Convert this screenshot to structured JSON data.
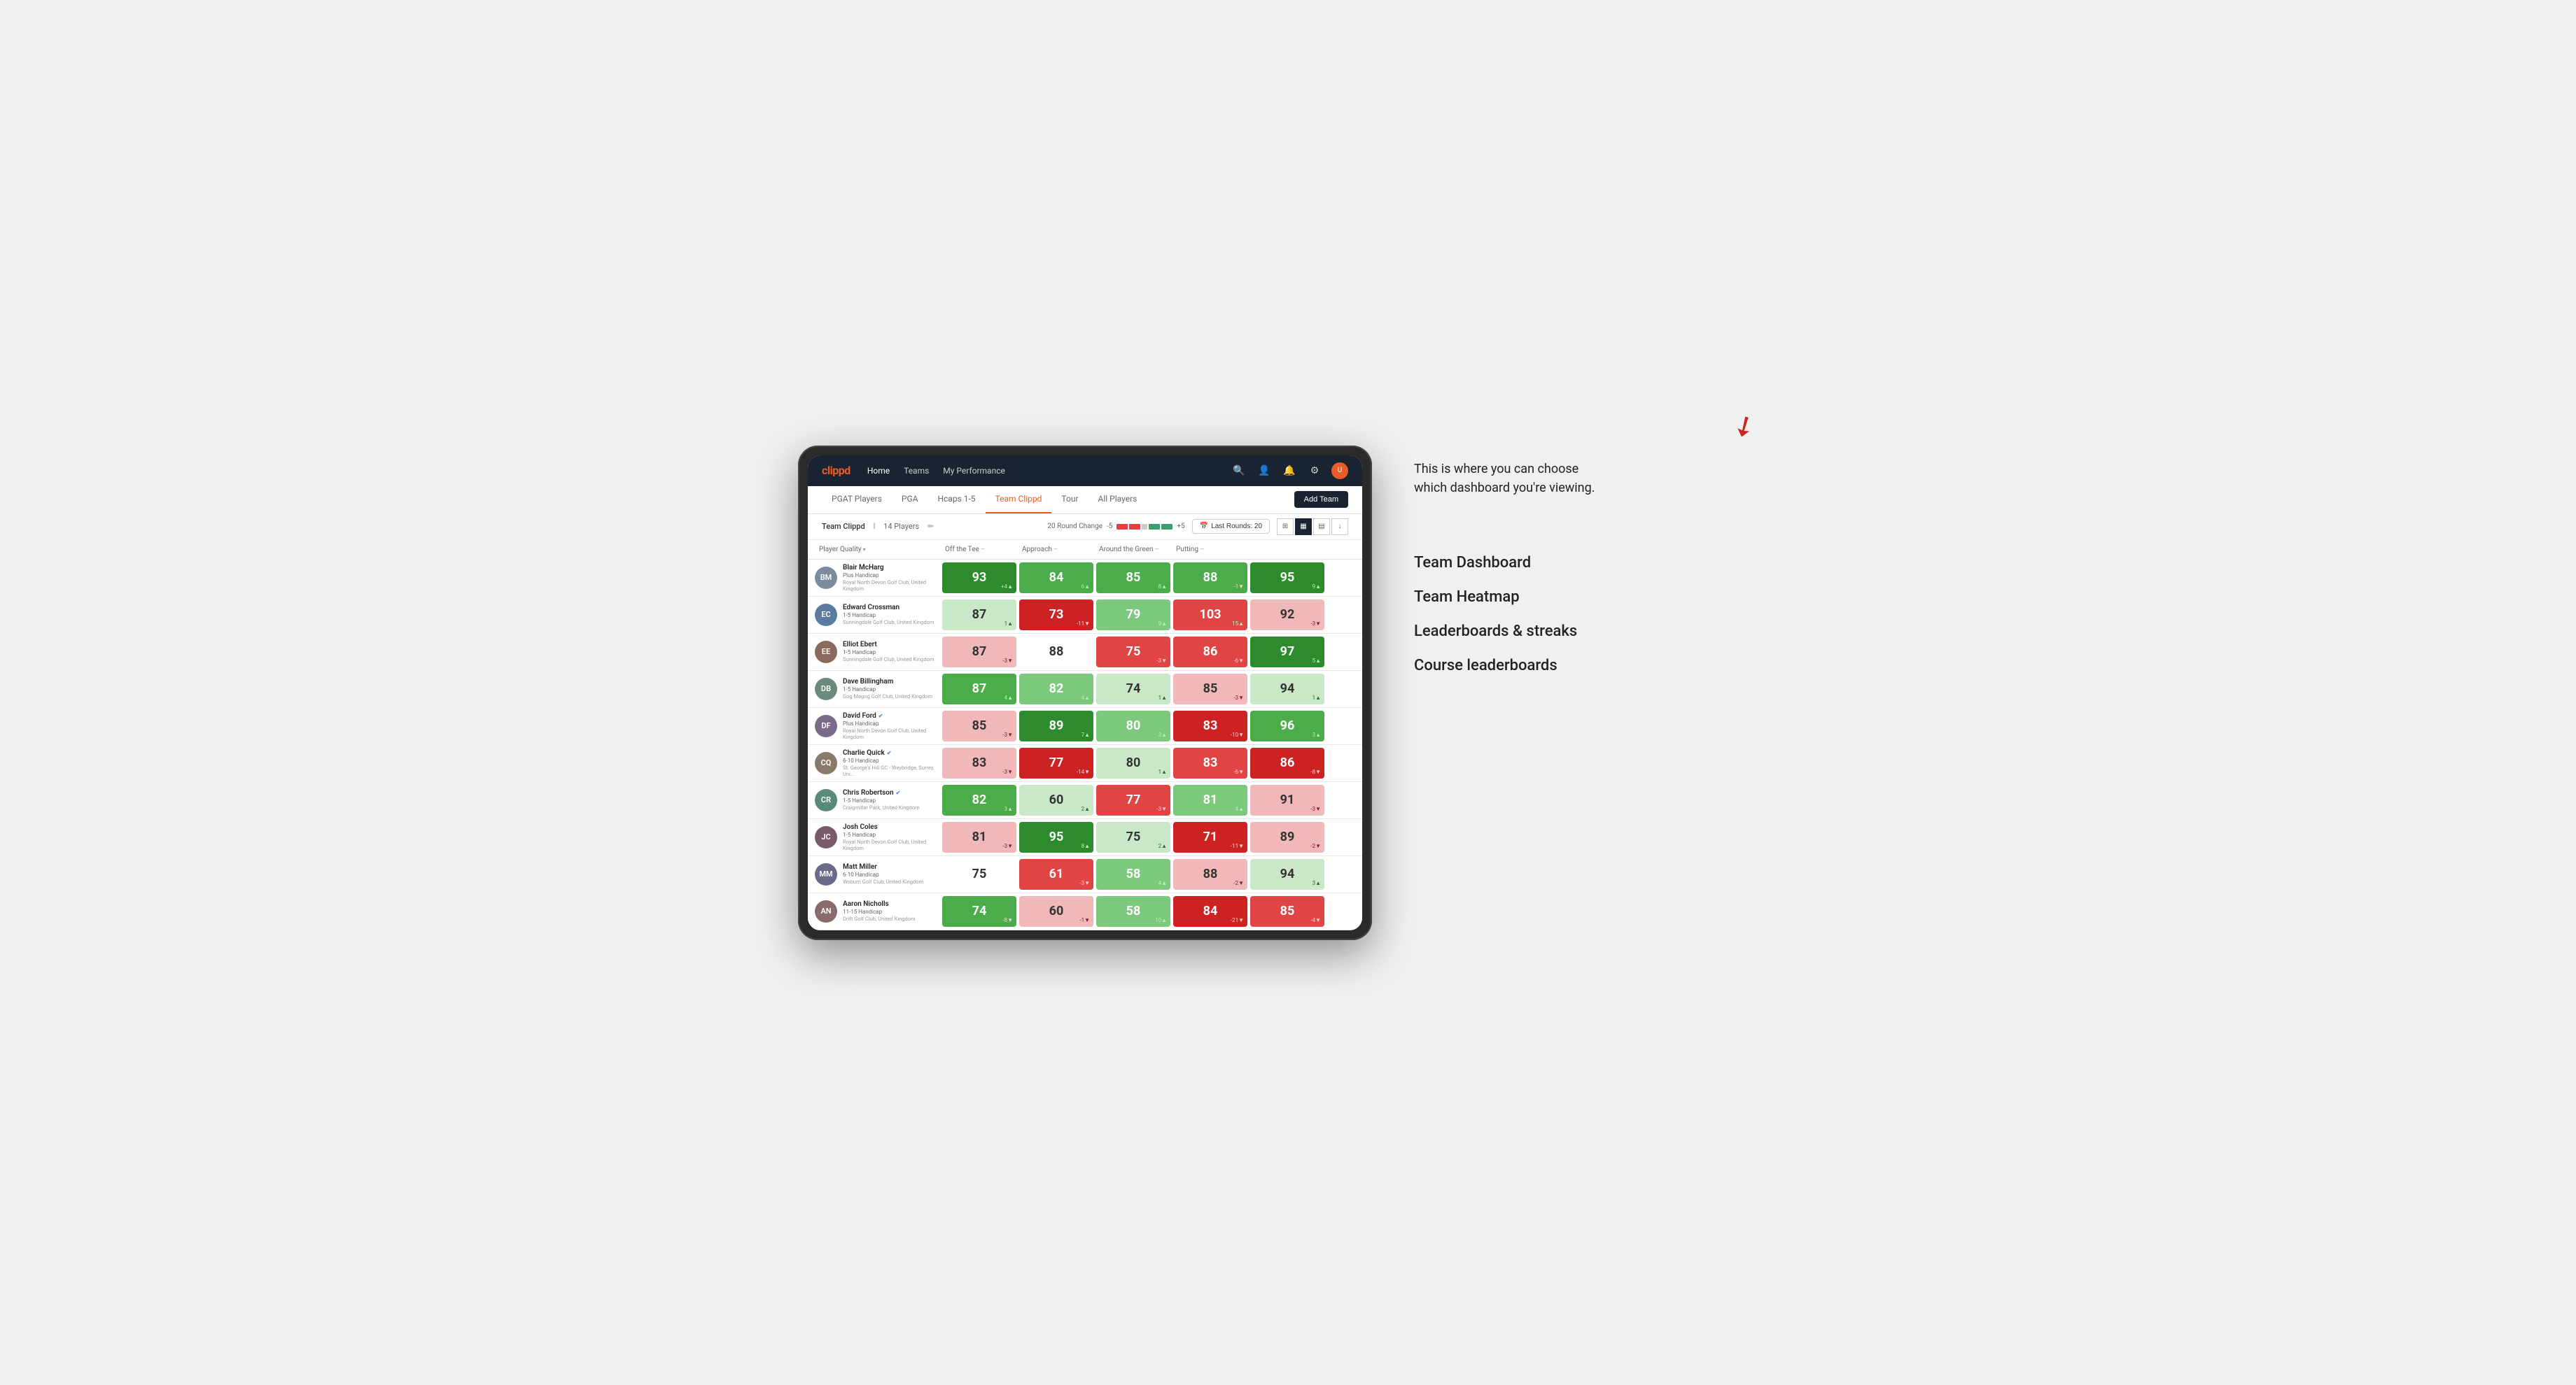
{
  "annotation": {
    "description": "This is where you can choose which dashboard you're viewing.",
    "options": [
      {
        "label": "Team Dashboard"
      },
      {
        "label": "Team Heatmap"
      },
      {
        "label": "Leaderboards & streaks"
      },
      {
        "label": "Course leaderboards"
      }
    ]
  },
  "nav": {
    "logo": "clippd",
    "links": [
      "Home",
      "Teams",
      "My Performance"
    ],
    "icons": [
      "search",
      "user",
      "bell",
      "settings"
    ]
  },
  "subNav": {
    "tabs": [
      "PGAT Players",
      "PGA",
      "Hcaps 1-5",
      "Team Clippd",
      "Tour",
      "All Players"
    ],
    "activeTab": "Team Clippd",
    "addTeamLabel": "Add Team"
  },
  "teamControls": {
    "teamName": "Team Clippd",
    "playerCount": "14 Players",
    "roundChangeLabel": "20 Round Change",
    "changeMin": "-5",
    "changePlus": "+5",
    "lastRoundsLabel": "Last Rounds: 20",
    "calendarIcon": "📅"
  },
  "tableHeaders": {
    "player": "Player Quality",
    "offTee": "Off the Tee",
    "approach": "Approach",
    "aroundGreen": "Around the Green",
    "putting": "Putting"
  },
  "players": [
    {
      "name": "Blair McHarg",
      "handicap": "Plus Handicap",
      "club": "Royal North Devon Golf Club, United Kingdom",
      "initials": "BM",
      "avatarColor": "#7a8c9e",
      "scores": {
        "quality": {
          "val": 93,
          "change": "+4",
          "dir": "up",
          "bg": "green-strong"
        },
        "offTee": {
          "val": 84,
          "change": "6",
          "dir": "up",
          "bg": "green-medium"
        },
        "approach": {
          "val": 85,
          "change": "8",
          "dir": "up",
          "bg": "green-medium"
        },
        "aroundGreen": {
          "val": 88,
          "change": "-1",
          "dir": "down",
          "bg": "green-medium"
        },
        "putting": {
          "val": 95,
          "change": "9",
          "dir": "up",
          "bg": "green-strong"
        }
      }
    },
    {
      "name": "Edward Crossman",
      "handicap": "1-5 Handicap",
      "club": "Sunningdale Golf Club, United Kingdom",
      "initials": "EC",
      "avatarColor": "#5a7a9e",
      "scores": {
        "quality": {
          "val": 87,
          "change": "1",
          "dir": "up",
          "bg": "green-pale"
        },
        "offTee": {
          "val": 73,
          "change": "-11",
          "dir": "down",
          "bg": "red-strong"
        },
        "approach": {
          "val": 79,
          "change": "9",
          "dir": "up",
          "bg": "green-light"
        },
        "aroundGreen": {
          "val": 103,
          "change": "15",
          "dir": "up",
          "bg": "red-medium"
        },
        "putting": {
          "val": 92,
          "change": "-3",
          "dir": "down",
          "bg": "red-pale"
        }
      }
    },
    {
      "name": "Elliot Ebert",
      "handicap": "1-5 Handicap",
      "club": "Sunningdale Golf Club, United Kingdom",
      "initials": "EE",
      "avatarColor": "#8a6a5a",
      "scores": {
        "quality": {
          "val": 87,
          "change": "-3",
          "dir": "down",
          "bg": "red-pale"
        },
        "offTee": {
          "val": 88,
          "change": "",
          "dir": "none",
          "bg": "white"
        },
        "approach": {
          "val": 75,
          "change": "-3",
          "dir": "down",
          "bg": "red-medium"
        },
        "aroundGreen": {
          "val": 86,
          "change": "-6",
          "dir": "down",
          "bg": "red-medium"
        },
        "putting": {
          "val": 97,
          "change": "5",
          "dir": "up",
          "bg": "green-strong"
        }
      }
    },
    {
      "name": "Dave Billingham",
      "handicap": "1-5 Handicap",
      "club": "Gog Magog Golf Club, United Kingdom",
      "initials": "DB",
      "avatarColor": "#6a8a7a",
      "scores": {
        "quality": {
          "val": 87,
          "change": "4",
          "dir": "up",
          "bg": "green-medium"
        },
        "offTee": {
          "val": 82,
          "change": "4",
          "dir": "up",
          "bg": "green-light"
        },
        "approach": {
          "val": 74,
          "change": "1",
          "dir": "up",
          "bg": "green-pale"
        },
        "aroundGreen": {
          "val": 85,
          "change": "-3",
          "dir": "down",
          "bg": "red-pale"
        },
        "putting": {
          "val": 94,
          "change": "1",
          "dir": "up",
          "bg": "green-pale"
        }
      }
    },
    {
      "name": "David Ford",
      "handicap": "Plus Handicap",
      "club": "Royal North Devon Golf Club, United Kingdom",
      "initials": "DF",
      "avatarColor": "#7a6a8a",
      "verified": true,
      "scores": {
        "quality": {
          "val": 85,
          "change": "-3",
          "dir": "down",
          "bg": "red-pale"
        },
        "offTee": {
          "val": 89,
          "change": "7",
          "dir": "up",
          "bg": "green-strong"
        },
        "approach": {
          "val": 80,
          "change": "3",
          "dir": "up",
          "bg": "green-light"
        },
        "aroundGreen": {
          "val": 83,
          "change": "-10",
          "dir": "down",
          "bg": "red-strong"
        },
        "putting": {
          "val": 96,
          "change": "3",
          "dir": "up",
          "bg": "green-medium"
        }
      }
    },
    {
      "name": "Charlie Quick",
      "handicap": "6-10 Handicap",
      "club": "St. George's Hill GC - Weybridge, Surrey, Uni...",
      "initials": "CQ",
      "avatarColor": "#8a7a6a",
      "verified": true,
      "scores": {
        "quality": {
          "val": 83,
          "change": "-3",
          "dir": "down",
          "bg": "red-pale"
        },
        "offTee": {
          "val": 77,
          "change": "-14",
          "dir": "down",
          "bg": "red-strong"
        },
        "approach": {
          "val": 80,
          "change": "1",
          "dir": "up",
          "bg": "green-pale"
        },
        "aroundGreen": {
          "val": 83,
          "change": "-6",
          "dir": "down",
          "bg": "red-medium"
        },
        "putting": {
          "val": 86,
          "change": "-8",
          "dir": "down",
          "bg": "red-strong"
        }
      }
    },
    {
      "name": "Chris Robertson",
      "handicap": "1-5 Handicap",
      "club": "Craigmillar Park, United Kingdom",
      "initials": "CR",
      "avatarColor": "#5a8a7a",
      "verified": true,
      "scores": {
        "quality": {
          "val": 82,
          "change": "3",
          "dir": "up",
          "bg": "green-medium"
        },
        "offTee": {
          "val": 60,
          "change": "2",
          "dir": "up",
          "bg": "green-pale"
        },
        "approach": {
          "val": 77,
          "change": "-3",
          "dir": "down",
          "bg": "red-medium"
        },
        "aroundGreen": {
          "val": 81,
          "change": "4",
          "dir": "up",
          "bg": "green-light"
        },
        "putting": {
          "val": 91,
          "change": "-3",
          "dir": "down",
          "bg": "red-pale"
        }
      }
    },
    {
      "name": "Josh Coles",
      "handicap": "1-5 Handicap",
      "club": "Royal North Devon Golf Club, United Kingdom",
      "initials": "JC",
      "avatarColor": "#7a5a6a",
      "scores": {
        "quality": {
          "val": 81,
          "change": "-3",
          "dir": "down",
          "bg": "red-pale"
        },
        "offTee": {
          "val": 95,
          "change": "8",
          "dir": "up",
          "bg": "green-strong"
        },
        "approach": {
          "val": 75,
          "change": "2",
          "dir": "up",
          "bg": "green-pale"
        },
        "aroundGreen": {
          "val": 71,
          "change": "-11",
          "dir": "down",
          "bg": "red-strong"
        },
        "putting": {
          "val": 89,
          "change": "-2",
          "dir": "down",
          "bg": "red-pale"
        }
      }
    },
    {
      "name": "Matt Miller",
      "handicap": "6-10 Handicap",
      "club": "Woburn Golf Club, United Kingdom",
      "initials": "MM",
      "avatarColor": "#6a6a8a",
      "scores": {
        "quality": {
          "val": 75,
          "change": "",
          "dir": "none",
          "bg": "white"
        },
        "offTee": {
          "val": 61,
          "change": "-3",
          "dir": "down",
          "bg": "red-medium"
        },
        "approach": {
          "val": 58,
          "change": "4",
          "dir": "up",
          "bg": "green-light"
        },
        "aroundGreen": {
          "val": 88,
          "change": "-2",
          "dir": "down",
          "bg": "red-pale"
        },
        "putting": {
          "val": 94,
          "change": "3",
          "dir": "up",
          "bg": "green-pale"
        }
      }
    },
    {
      "name": "Aaron Nicholls",
      "handicap": "11-15 Handicap",
      "club": "Drift Golf Club, United Kingdom",
      "initials": "AN",
      "avatarColor": "#8a6a6a",
      "scores": {
        "quality": {
          "val": 74,
          "change": "-8",
          "dir": "down",
          "bg": "green-medium"
        },
        "offTee": {
          "val": 60,
          "change": "-1",
          "dir": "down",
          "bg": "red-pale"
        },
        "approach": {
          "val": 58,
          "change": "10",
          "dir": "up",
          "bg": "green-light"
        },
        "aroundGreen": {
          "val": 84,
          "change": "-21",
          "dir": "down",
          "bg": "red-strong"
        },
        "putting": {
          "val": 85,
          "change": "-4",
          "dir": "down",
          "bg": "red-medium"
        }
      }
    }
  ]
}
